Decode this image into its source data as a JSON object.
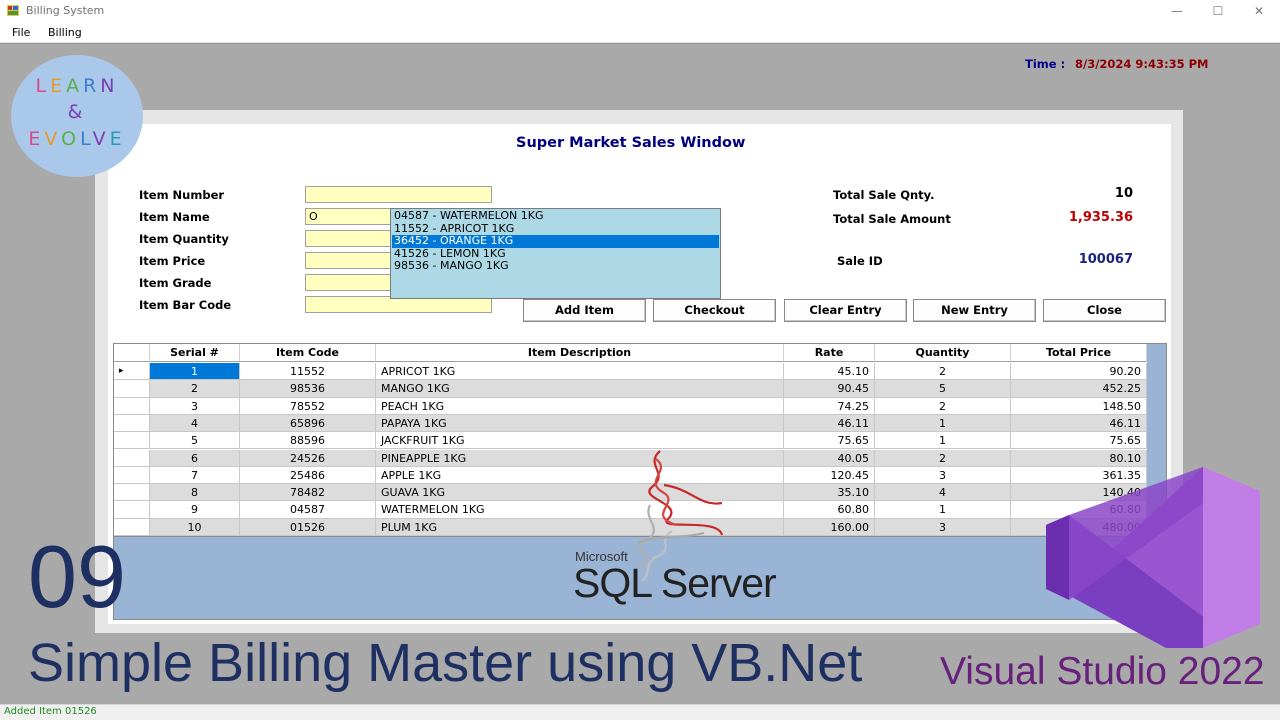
{
  "window": {
    "title": "Billing System",
    "controls": {
      "minimize": "—",
      "maximize": "☐",
      "close": "✕"
    }
  },
  "menu": [
    "File",
    "Billing"
  ],
  "clock": {
    "label": "Time :",
    "value": "8/3/2024 9:43:35 PM"
  },
  "logo": {
    "line1": "LEARN",
    "line2": "&",
    "line3": "EVOLVE",
    "colors": [
      "#d94a8c",
      "#e39b2c",
      "#58b047",
      "#3b7fd1",
      "#7b3fb4",
      "#2a9bb6"
    ]
  },
  "sales_window": {
    "title": "Super Market Sales Window",
    "fields": [
      {
        "label": "Item Number",
        "value": ""
      },
      {
        "label": "Item Name",
        "value": "O"
      },
      {
        "label": "Item Quantity",
        "value": ""
      },
      {
        "label": "Item Price",
        "value": ""
      },
      {
        "label": "Item Grade",
        "value": ""
      },
      {
        "label": "Item Bar Code",
        "value": ""
      }
    ],
    "suggestions": [
      {
        "text": "04587 - WATERMELON 1KG",
        "selected": false
      },
      {
        "text": "11552 - APRICOT 1KG",
        "selected": false
      },
      {
        "text": "36452 - ORANGE 1KG",
        "selected": true
      },
      {
        "text": "41526 - LEMON 1KG",
        "selected": false
      },
      {
        "text": "98536 - MANGO 1KG",
        "selected": false
      }
    ],
    "summary": {
      "total_qty_label": "Total Sale Qnty.",
      "total_qty_value": "10",
      "total_amount_label": "Total Sale Amount",
      "total_amount_value": "1,935.36",
      "sale_id_label": "Sale ID",
      "sale_id_value": "100067"
    },
    "buttons": [
      "Add Item",
      "Checkout",
      "Clear Entry",
      "New Entry",
      "Close"
    ],
    "grid": {
      "columns": [
        "Serial #",
        "Item Code",
        "Item Description",
        "Rate",
        "Quantity",
        "Total Price"
      ],
      "row_marker": "▸",
      "rows": [
        [
          "1",
          "11552",
          "APRICOT 1KG",
          "45.10",
          "2",
          "90.20"
        ],
        [
          "2",
          "98536",
          "MANGO 1KG",
          "90.45",
          "5",
          "452.25"
        ],
        [
          "3",
          "78552",
          "PEACH 1KG",
          "74.25",
          "2",
          "148.50"
        ],
        [
          "4",
          "65896",
          "PAPAYA 1KG",
          "46.11",
          "1",
          "46.11"
        ],
        [
          "5",
          "88596",
          "JACKFRUIT 1KG",
          "75.65",
          "1",
          "75.65"
        ],
        [
          "6",
          "24526",
          "PINEAPPLE 1KG",
          "40.05",
          "2",
          "80.10"
        ],
        [
          "7",
          "25486",
          "APPLE 1KG",
          "120.45",
          "3",
          "361.35"
        ],
        [
          "8",
          "78482",
          "GUAVA 1KG",
          "35.10",
          "4",
          "140.40"
        ],
        [
          "9",
          "04587",
          "WATERMELON 1KG",
          "60.80",
          "1",
          "60.80"
        ],
        [
          "10",
          "01526",
          "PLUM 1KG",
          "160.00",
          "3",
          "480.00"
        ]
      ]
    }
  },
  "status_bar": "Added Item 01526",
  "overlay": {
    "episode": "09",
    "caption": "Simple Billing Master using VB.Net",
    "vs_caption": "Visual Studio 2022",
    "sql_brand_small": "Microsoft",
    "sql_brand": "SQL Server"
  },
  "colors": {
    "input_bg": "#ffffc0",
    "dropdown_bg": "#add8e6",
    "selection": "#0078d7",
    "total_amount": "#c00000",
    "sale_id": "#1a237e",
    "caption": "#1e2f62",
    "vs_purple": "#68217a"
  }
}
